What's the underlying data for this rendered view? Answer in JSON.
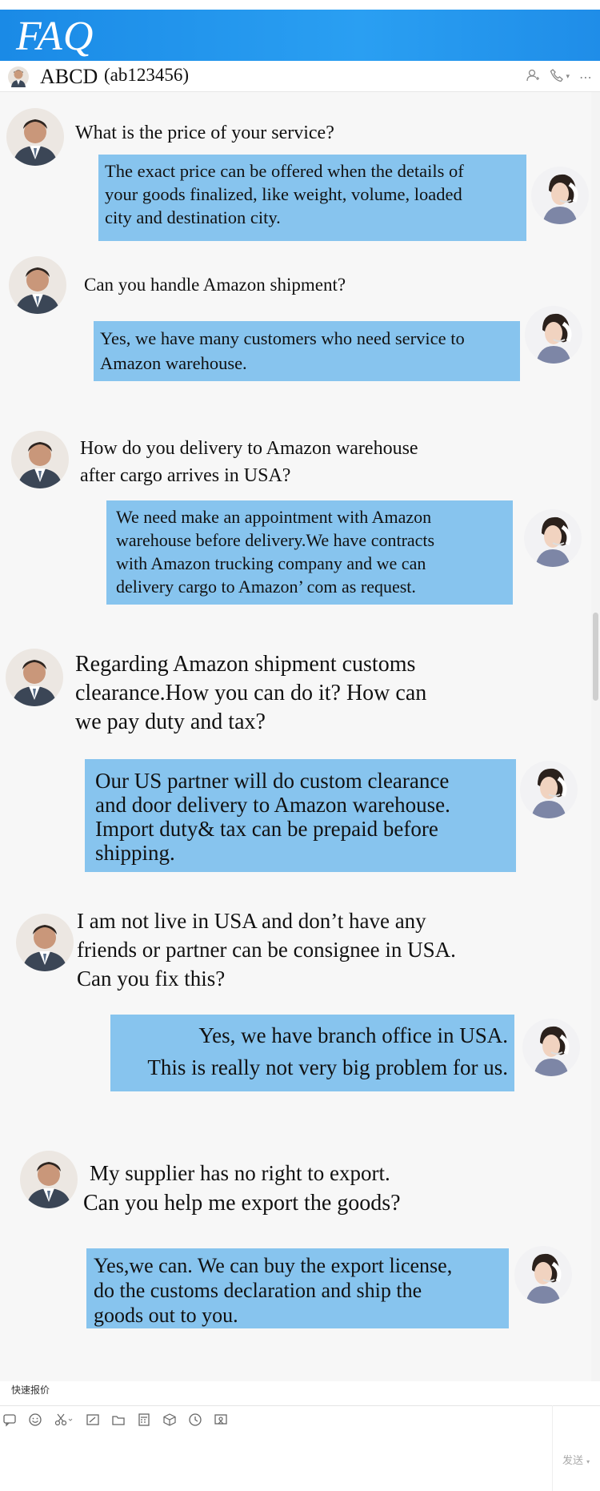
{
  "banner": {
    "title": "FAQ"
  },
  "header": {
    "contact_name": "ABCD",
    "contact_id": "(ab123456)",
    "icons": [
      "add-contact-icon",
      "phone-icon",
      "dropdown-icon",
      "more-icon"
    ]
  },
  "messages": [
    {
      "question": "What is the price of your service?",
      "answer": [
        "The exact price can be offered when the details of",
        "your goods finalized, like weight, volume, loaded",
        "city and destination city."
      ]
    },
    {
      "question": "Can you handle Amazon shipment?",
      "answer": [
        "Yes, we have many customers who need service to",
        "Amazon warehouse."
      ]
    },
    {
      "question": "How do you delivery to Amazon warehouse after cargo arrives in USA?",
      "question_lines": [
        "How do you delivery to Amazon warehouse",
        "after cargo arrives in USA?"
      ],
      "answer": [
        "We need make an appointment with Amazon",
        "warehouse before delivery.We have contracts",
        "with Amazon trucking company and we can",
        "delivery cargo to Amazon’ com as request."
      ]
    },
    {
      "question_lines": [
        "Regarding Amazon shipment customs",
        "clearance.How you can do it? How can",
        "we pay duty and tax?"
      ],
      "answer": [
        "Our US partner will do custom clearance",
        "and door delivery to Amazon warehouse.",
        "Import duty& tax can be prepaid before",
        "shipping."
      ]
    },
    {
      "question_lines": [
        "I am not live in USA and don’t have any",
        "friends or partner can be consignee in USA.",
        "Can you fix this?"
      ],
      "answer": [
        "Yes, we have branch office in USA.",
        "This is really not very big problem for us."
      ]
    },
    {
      "question_lines": [
        "My supplier has no right to export.",
        "Can you help me export the goods?"
      ],
      "answer": [
        "Yes,we can. We can buy the export license,",
        "do the customs declaration and ship the",
        "goods out to you."
      ]
    }
  ],
  "composer": {
    "quick_quote_label": "快速报价",
    "send_label": "发送",
    "toolbar_icons": [
      "feedback-icon",
      "emoji-icon",
      "scissors-icon",
      "screenshot-icon",
      "folder-icon",
      "calculator-icon",
      "package-icon",
      "history-icon",
      "image-icon"
    ]
  },
  "colors": {
    "banner": "#1f8de8",
    "bubble": "#87c4ee",
    "chat_bg": "#f7f7f7"
  }
}
